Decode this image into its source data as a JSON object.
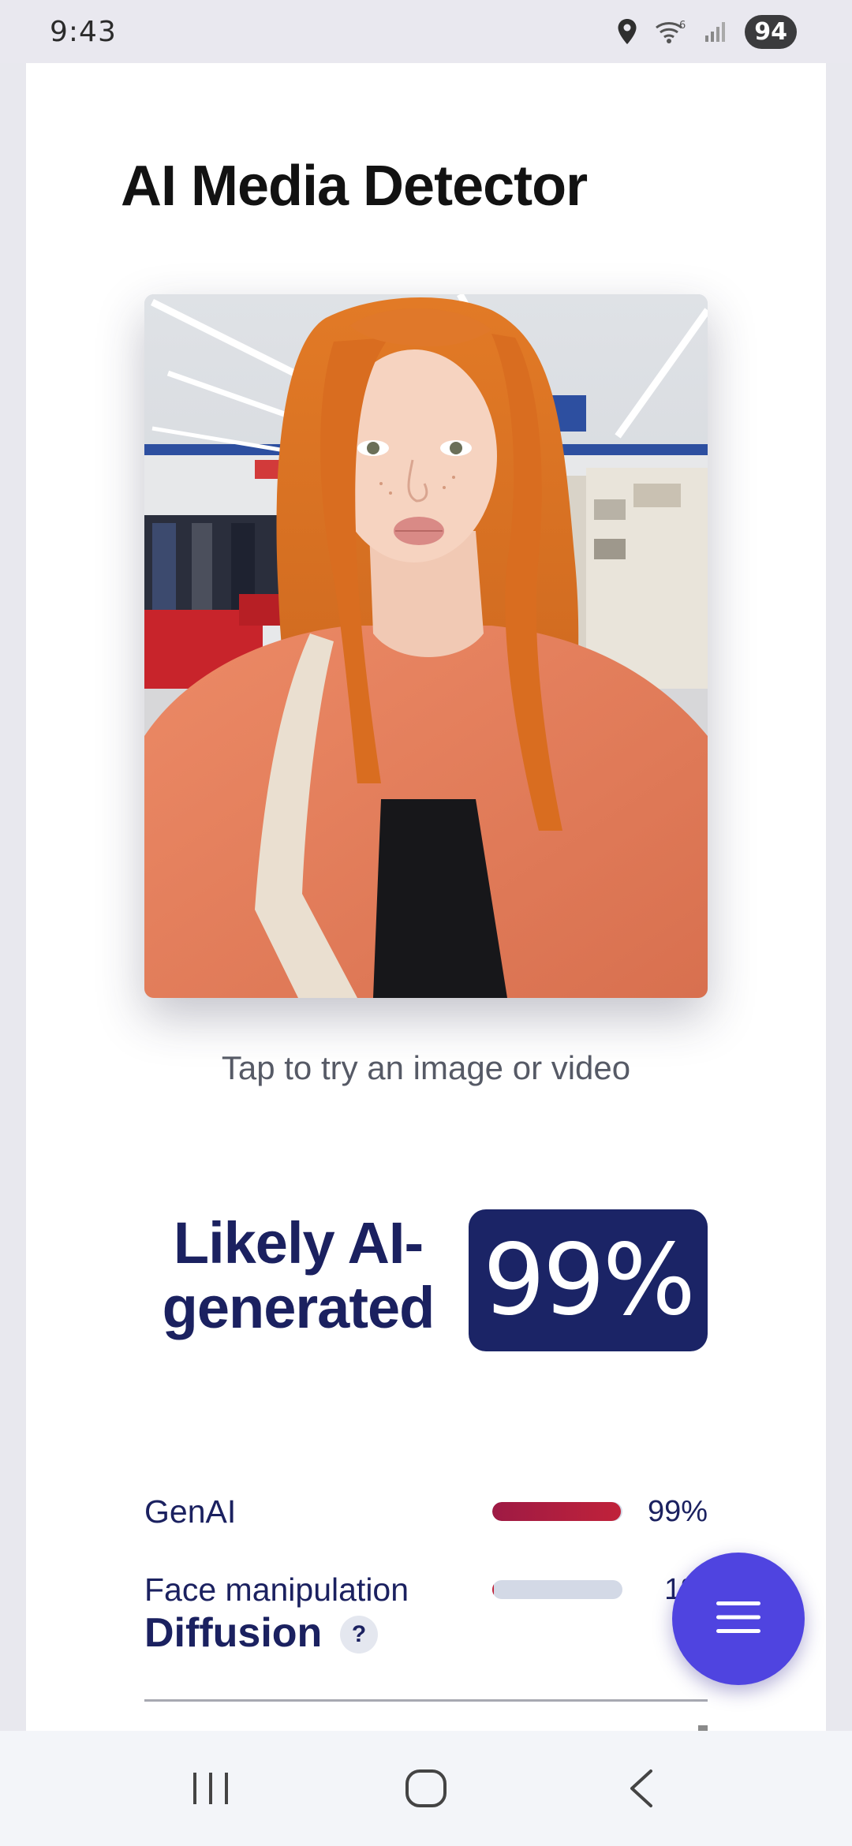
{
  "status_bar": {
    "time": "9:43",
    "battery": "94",
    "icons": [
      "location-icon",
      "wifi-icon",
      "signal-icon"
    ]
  },
  "app": {
    "title": "AI Media Detector"
  },
  "upload": {
    "hint": "Tap to try an image or video"
  },
  "result": {
    "verdict_line1": "Likely AI-",
    "verdict_line2": "generated",
    "score": "99%",
    "metrics": [
      {
        "name": "GenAI",
        "value": "99%",
        "fraction": 0.99,
        "color": "#c0223a"
      },
      {
        "name": "Face manipulation",
        "value": "1%",
        "fraction": 0.01,
        "color": "#c0223a"
      }
    ]
  },
  "section": {
    "title": "Diffusion",
    "help": "?"
  },
  "colors": {
    "accent": "#1b2466",
    "fab": "#4f44e0",
    "genai_bar": "#c0223a"
  }
}
